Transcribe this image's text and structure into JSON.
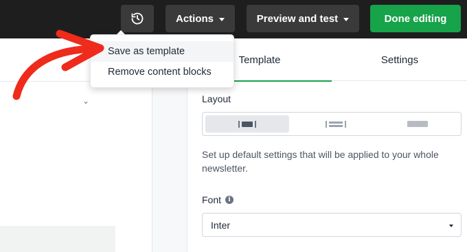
{
  "topbar": {
    "history_icon": "history-icon",
    "actions_label": "Actions",
    "preview_label": "Preview and test",
    "done_label": "Done editing"
  },
  "actions_menu": {
    "items": [
      {
        "label": "Save as template"
      },
      {
        "label": "Remove content blocks"
      }
    ]
  },
  "panel": {
    "tabs": [
      {
        "label": "Template",
        "active": true
      },
      {
        "label": "Settings",
        "active": false
      }
    ],
    "layout_label": "Layout",
    "layout_options": [
      {
        "icon": "layout-centered-icon",
        "selected": true
      },
      {
        "icon": "layout-full-width-icon",
        "selected": false
      },
      {
        "icon": "layout-wide-icon",
        "selected": false
      }
    ],
    "description": "Set up default settings that will be applied to your whole newsletter.",
    "font_label": "Font",
    "font_value": "Inter"
  },
  "colors": {
    "topbar_bg": "#1e1e1e",
    "done_button": "#16a34a",
    "annotation_arrow": "#ef2b1c"
  }
}
